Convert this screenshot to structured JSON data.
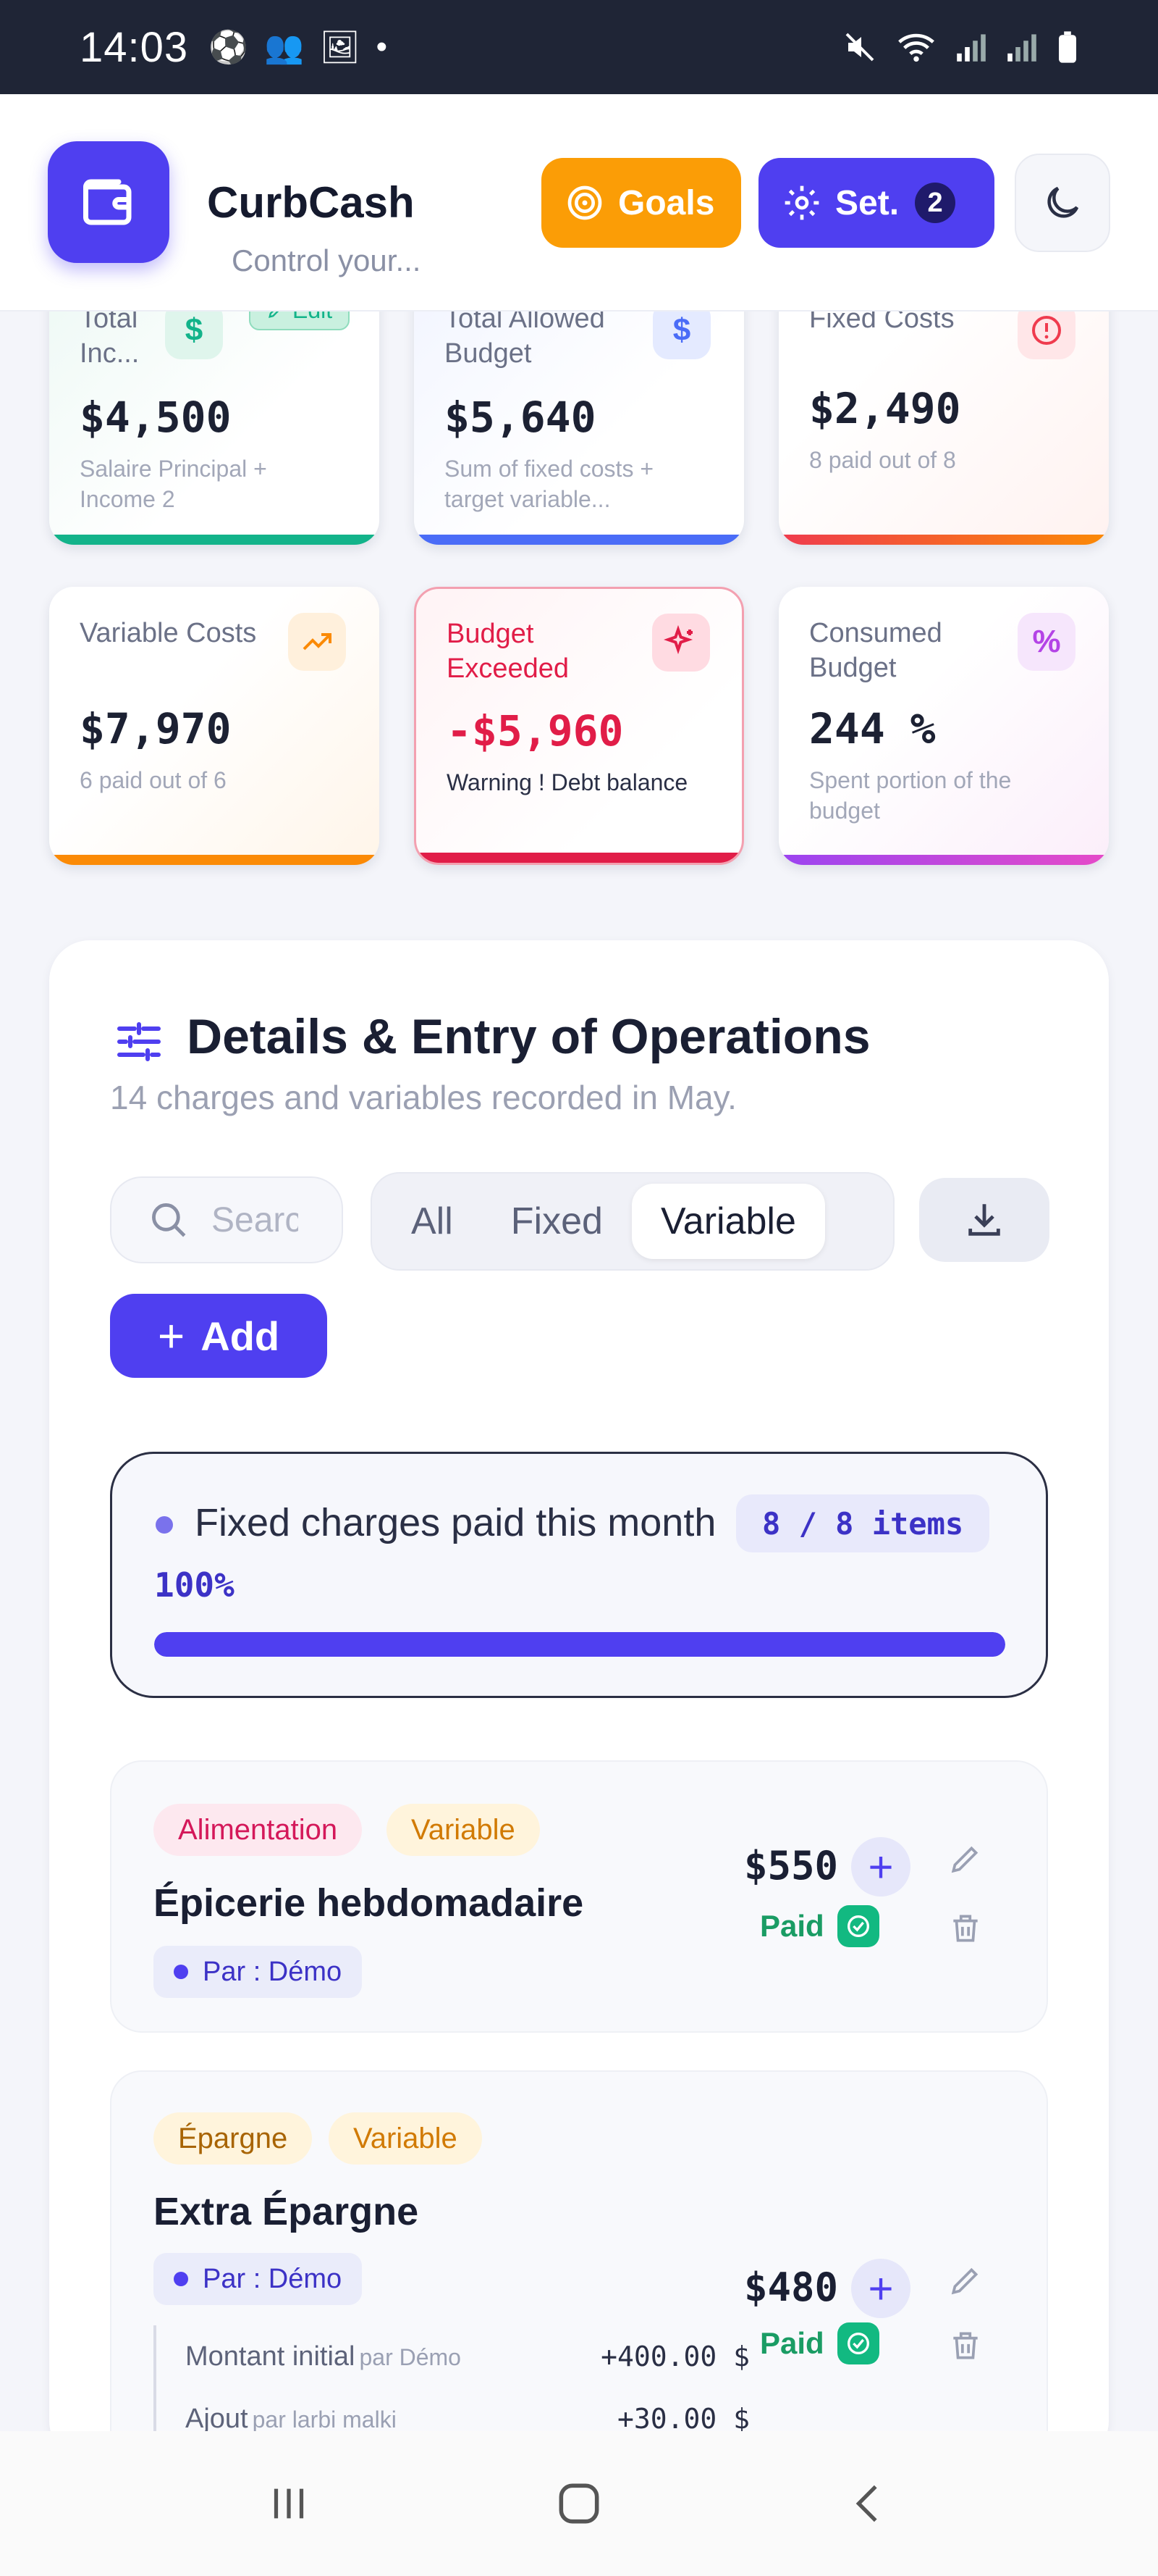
{
  "status": {
    "time": "14:03"
  },
  "header": {
    "app_name": "CurbCash",
    "tagline": "Control your...",
    "goals_label": "Goals",
    "settings_label": "Set.",
    "settings_badge": "2"
  },
  "cards": [
    {
      "label": "Total Inc...",
      "amount": "$4,500",
      "sub": "Salaire Principal + Income 2",
      "edit_label": "Edit",
      "icon": "dollar-icon",
      "color": "#13b38a"
    },
    {
      "label": "Total Allowed Budget",
      "amount": "$5,640",
      "sub": "Sum of fixed costs + target variable...",
      "icon": "dollar-icon",
      "color": "#4a6cf7"
    },
    {
      "label": "Fixed Costs",
      "amount": "$2,490",
      "sub": "8 paid out of 8",
      "icon": "alert-icon",
      "color": "#ef3b4e"
    },
    {
      "label": "Variable Costs",
      "amount": "$7,970",
      "sub": "6 paid out of 6",
      "icon": "trend-up-icon",
      "color": "#fb8a06"
    },
    {
      "label": "Budget Exceeded",
      "amount": "-$5,960",
      "sub": "Warning ! Debt balance",
      "icon": "sparkle-icon",
      "color": "#e11d48"
    },
    {
      "label": "Consumed Budget",
      "amount": "244 %",
      "sub": "Spent portion of the budget",
      "icon": "percent-icon",
      "color": "#b444e6"
    }
  ],
  "details": {
    "title": "Details & Entry of Operations",
    "subtitle": "14 charges and variables recorded in May.",
    "search_placeholder": "Search",
    "filters": [
      "All",
      "Fixed",
      "Variable"
    ],
    "active_filter": "Variable",
    "add_label": "Add",
    "progress": {
      "label": "Fixed charges paid this month",
      "count": "8 / 8 items",
      "percent_text": "100%",
      "fraction": 1.0
    }
  },
  "items": [
    {
      "category": "Alimentation",
      "type": "Variable",
      "name": "Épicerie hebdomadaire",
      "by": "Par : Démo",
      "price": "$550",
      "status": "Paid"
    },
    {
      "category": "Épargne",
      "type": "Variable",
      "name": "Extra Épargne",
      "by": "Par : Démo",
      "price": "$480",
      "status": "Paid",
      "history": [
        {
          "label": "Montant initial",
          "who": "par Démo",
          "value": "+400.00 $"
        },
        {
          "label": "Ajout",
          "who": "par larbi malki",
          "value": "+30.00 $"
        }
      ]
    }
  ]
}
